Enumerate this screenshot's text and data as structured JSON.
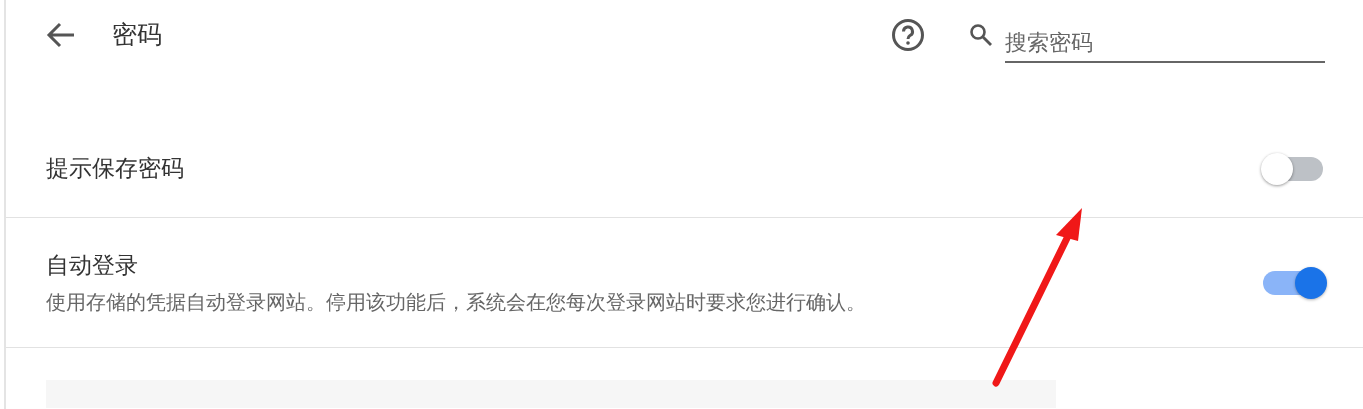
{
  "header": {
    "title": "密码",
    "search": {
      "placeholder": "搜索密码"
    }
  },
  "settings": [
    {
      "label": "提示保存密码",
      "on": false
    },
    {
      "label": "自动登录",
      "description": "使用存储的凭据自动登录网站。停用该功能后，系统会在您每次登录网站时要求您进行确认。",
      "on": true
    }
  ]
}
